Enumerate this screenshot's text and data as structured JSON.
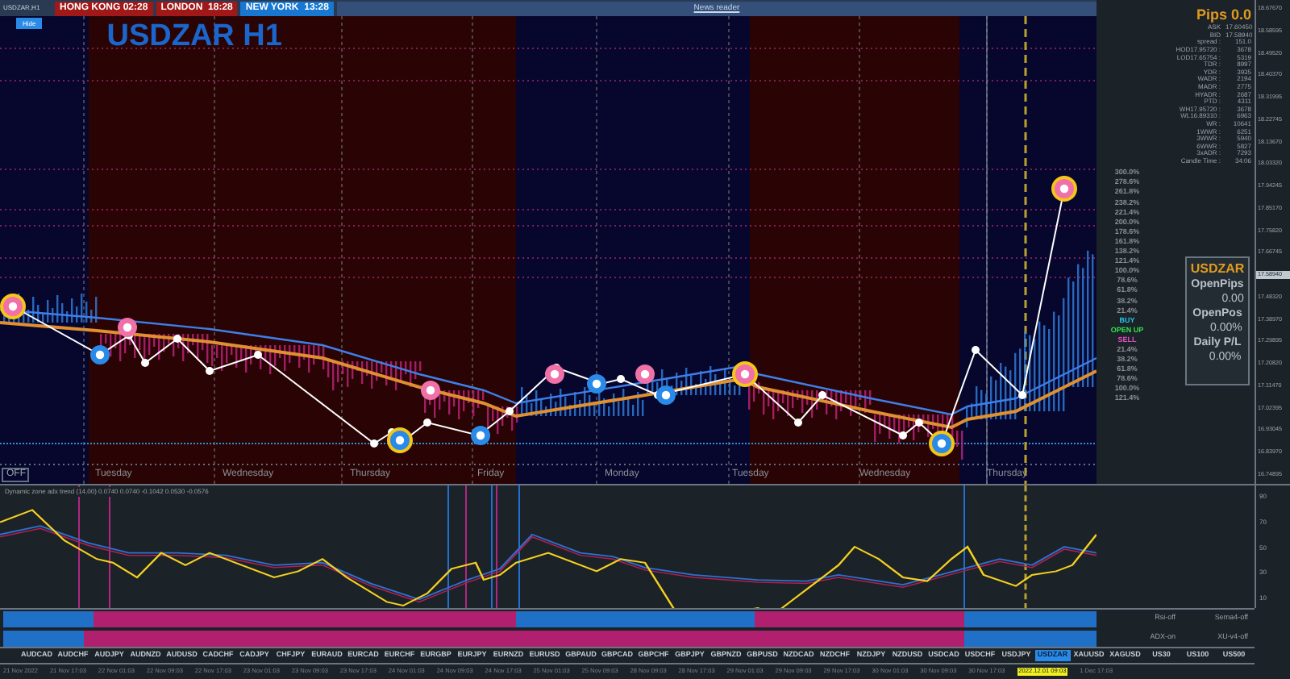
{
  "chart": {
    "symbol_label": "USDZAR,H1",
    "title": "USDZAR H1",
    "hide_button": "Hide",
    "off_button": "OFF",
    "news_reader": "News reader"
  },
  "clocks": [
    {
      "label": "HONG KONG 02:28",
      "color": "#a01818"
    },
    {
      "label": "LONDON  18:28",
      "color": "#a01818"
    },
    {
      "label": "NEW YORK  13:28",
      "color": "#1877d0"
    }
  ],
  "days": [
    "Tuesday",
    "Wednesday",
    "Thursday",
    "Friday",
    "Monday",
    "Tuesday",
    "Wednesday",
    "Thursday"
  ],
  "info": {
    "pips": "Pips 0.0",
    "rows": [
      {
        "label": "ASK",
        "value": "17.60450"
      },
      {
        "label": "BID",
        "value": "17.58940"
      },
      {
        "label": "spread :",
        "value": "151.0"
      },
      {
        "label": "HOD17.95720 :",
        "value": "3678"
      },
      {
        "label": "LOD17.65754 :",
        "value": "5319"
      },
      {
        "label": "TDR :",
        "value": "8997"
      },
      {
        "label": "YDR :",
        "value": "3935"
      },
      {
        "label": "WADR :",
        "value": "2194"
      },
      {
        "label": "MADR :",
        "value": "2775"
      },
      {
        "label": "HYADR :",
        "value": "2687"
      },
      {
        "label": "PTD :",
        "value": "4311"
      },
      {
        "label": "WH17.95720 :",
        "value": "3678"
      },
      {
        "label": "WL16.89310 :",
        "value": "6963"
      },
      {
        "label": "WR :",
        "value": "10641"
      },
      {
        "label": "1WWR :",
        "value": "6251"
      },
      {
        "label": "3WWR :",
        "value": "5940"
      },
      {
        "label": "6WWR :",
        "value": "5827"
      },
      {
        "label": "3xADR :",
        "value": "7293"
      },
      {
        "label": "Candle Time :",
        "value": "34:06"
      }
    ],
    "levels": [
      {
        "label": "300.0%",
        "kind": "level"
      },
      {
        "label": "278.6%",
        "kind": "level"
      },
      {
        "label": "261.8%",
        "kind": "level"
      },
      {
        "label": "238.2%",
        "kind": "level"
      },
      {
        "label": "221.4%",
        "kind": "level"
      },
      {
        "label": "200.0%",
        "kind": "level"
      },
      {
        "label": "178.6%",
        "kind": "level"
      },
      {
        "label": "161.8%",
        "kind": "level"
      },
      {
        "label": "138.2%",
        "kind": "level"
      },
      {
        "label": "121.4%",
        "kind": "level"
      },
      {
        "label": "100.0%",
        "kind": "level"
      },
      {
        "label": "78.6%",
        "kind": "level"
      },
      {
        "label": "61.8%",
        "kind": "level"
      },
      {
        "label": "38.2%",
        "kind": "level"
      },
      {
        "label": "21.4%",
        "kind": "level"
      },
      {
        "label": "BUY",
        "kind": "buy"
      },
      {
        "label": "OPEN UP",
        "kind": "open"
      },
      {
        "label": "SELL",
        "kind": "sell"
      },
      {
        "label": "21.4%",
        "kind": "level"
      },
      {
        "label": "38.2%",
        "kind": "level"
      },
      {
        "label": "61.8%",
        "kind": "level"
      },
      {
        "label": "78.6%",
        "kind": "level"
      },
      {
        "label": "100.0%",
        "kind": "level"
      },
      {
        "label": "121.4%",
        "kind": "level"
      }
    ],
    "box": {
      "symbol": "USDZAR",
      "items": [
        {
          "label": "OpenPips",
          "value": "0.00"
        },
        {
          "label": "OpenPos",
          "value": "0.00%"
        },
        {
          "label": "Daily P/L",
          "value": "0.00%"
        }
      ]
    }
  },
  "price_axis": [
    {
      "label": "18.67670",
      "selected": false
    },
    {
      "label": "18.58595",
      "selected": false
    },
    {
      "label": "18.49520",
      "selected": false
    },
    {
      "label": "18.40370",
      "selected": false
    },
    {
      "label": "18.31995",
      "selected": false
    },
    {
      "label": "18.22745",
      "selected": false
    },
    {
      "label": "18.13670",
      "selected": false
    },
    {
      "label": "18.03320",
      "selected": false
    },
    {
      "label": "17.94245",
      "selected": false
    },
    {
      "label": "17.85170",
      "selected": false
    },
    {
      "label": "17.75820",
      "selected": false
    },
    {
      "label": "17.66745",
      "selected": false
    },
    {
      "label": "17.58940",
      "selected": true
    },
    {
      "label": "17.48320",
      "selected": false
    },
    {
      "label": "17.38970",
      "selected": false
    },
    {
      "label": "17.29895",
      "selected": false
    },
    {
      "label": "17.20820",
      "selected": false
    },
    {
      "label": "17.11470",
      "selected": false
    },
    {
      "label": "17.02395",
      "selected": false
    },
    {
      "label": "16.93045",
      "selected": false
    },
    {
      "label": "16.83970",
      "selected": false
    },
    {
      "label": "16.74895",
      "selected": false
    }
  ],
  "indicator": {
    "legend": "Dynamic zone adx trend (14,00) 0.0740 0.0740 -0.1042 0.0530 -0.0576",
    "axis": [
      "90",
      "70",
      "50",
      "30",
      "10"
    ],
    "switches": [
      "Rsi-off",
      "Sema4-off",
      "ADX-on",
      "XU-v4-off"
    ]
  },
  "symbols": [
    {
      "label": "AUDCAD",
      "selected": false
    },
    {
      "label": "AUDCHF",
      "selected": false
    },
    {
      "label": "AUDJPY",
      "selected": false
    },
    {
      "label": "AUDNZD",
      "selected": false
    },
    {
      "label": "AUDUSD",
      "selected": false
    },
    {
      "label": "CADCHF",
      "selected": false
    },
    {
      "label": "CADJPY",
      "selected": false
    },
    {
      "label": "CHFJPY",
      "selected": false
    },
    {
      "label": "EURAUD",
      "selected": false
    },
    {
      "label": "EURCAD",
      "selected": false
    },
    {
      "label": "EURCHF",
      "selected": false
    },
    {
      "label": "EURGBP",
      "selected": false
    },
    {
      "label": "EURJPY",
      "selected": false
    },
    {
      "label": "EURNZD",
      "selected": false
    },
    {
      "label": "EURUSD",
      "selected": false
    },
    {
      "label": "GBPAUD",
      "selected": false
    },
    {
      "label": "GBPCAD",
      "selected": false
    },
    {
      "label": "GBPCHF",
      "selected": false
    },
    {
      "label": "GBPJPY",
      "selected": false
    },
    {
      "label": "GBPNZD",
      "selected": false
    },
    {
      "label": "GBPUSD",
      "selected": false
    },
    {
      "label": "NZDCAD",
      "selected": false
    },
    {
      "label": "NZDCHF",
      "selected": false
    },
    {
      "label": "NZDJPY",
      "selected": false
    },
    {
      "label": "NZDUSD",
      "selected": false
    },
    {
      "label": "USDCAD",
      "selected": false
    },
    {
      "label": "USDCHF",
      "selected": false
    },
    {
      "label": "USDJPY",
      "selected": false
    },
    {
      "label": "USDZAR",
      "selected": true
    },
    {
      "label": "XAUUSD",
      "selected": false
    },
    {
      "label": "XAGUSD",
      "selected": false
    },
    {
      "label": "US30",
      "selected": false
    },
    {
      "label": "US100",
      "selected": false
    },
    {
      "label": "US500",
      "selected": false
    }
  ],
  "time_axis": [
    {
      "label": "21 Nov 2022",
      "selected": false
    },
    {
      "label": "21 Nov 17:03",
      "selected": false
    },
    {
      "label": "22 Nov 01:03",
      "selected": false
    },
    {
      "label": "22 Nov 09:03",
      "selected": false
    },
    {
      "label": "22 Nov 17:03",
      "selected": false
    },
    {
      "label": "23 Nov 01:03",
      "selected": false
    },
    {
      "label": "23 Nov 09:03",
      "selected": false
    },
    {
      "label": "23 Nov 17:03",
      "selected": false
    },
    {
      "label": "24 Nov 01:03",
      "selected": false
    },
    {
      "label": "24 Nov 09:03",
      "selected": false
    },
    {
      "label": "24 Nov 17:03",
      "selected": false
    },
    {
      "label": "25 Nov 01:03",
      "selected": false
    },
    {
      "label": "25 Nov 09:03",
      "selected": false
    },
    {
      "label": "28 Nov 09:03",
      "selected": false
    },
    {
      "label": "28 Nov 17:03",
      "selected": false
    },
    {
      "label": "29 Nov 01:03",
      "selected": false
    },
    {
      "label": "29 Nov 09:03",
      "selected": false
    },
    {
      "label": "29 Nov 17:03",
      "selected": false
    },
    {
      "label": "30 Nov 01:03",
      "selected": false
    },
    {
      "label": "30 Nov 09:03",
      "selected": false
    },
    {
      "label": "30 Nov 17:03",
      "selected": false
    },
    {
      "label": "2022.12.01 09:03",
      "selected": true
    },
    {
      "label": "1 Dec 17:03",
      "selected": false
    }
  ]
}
